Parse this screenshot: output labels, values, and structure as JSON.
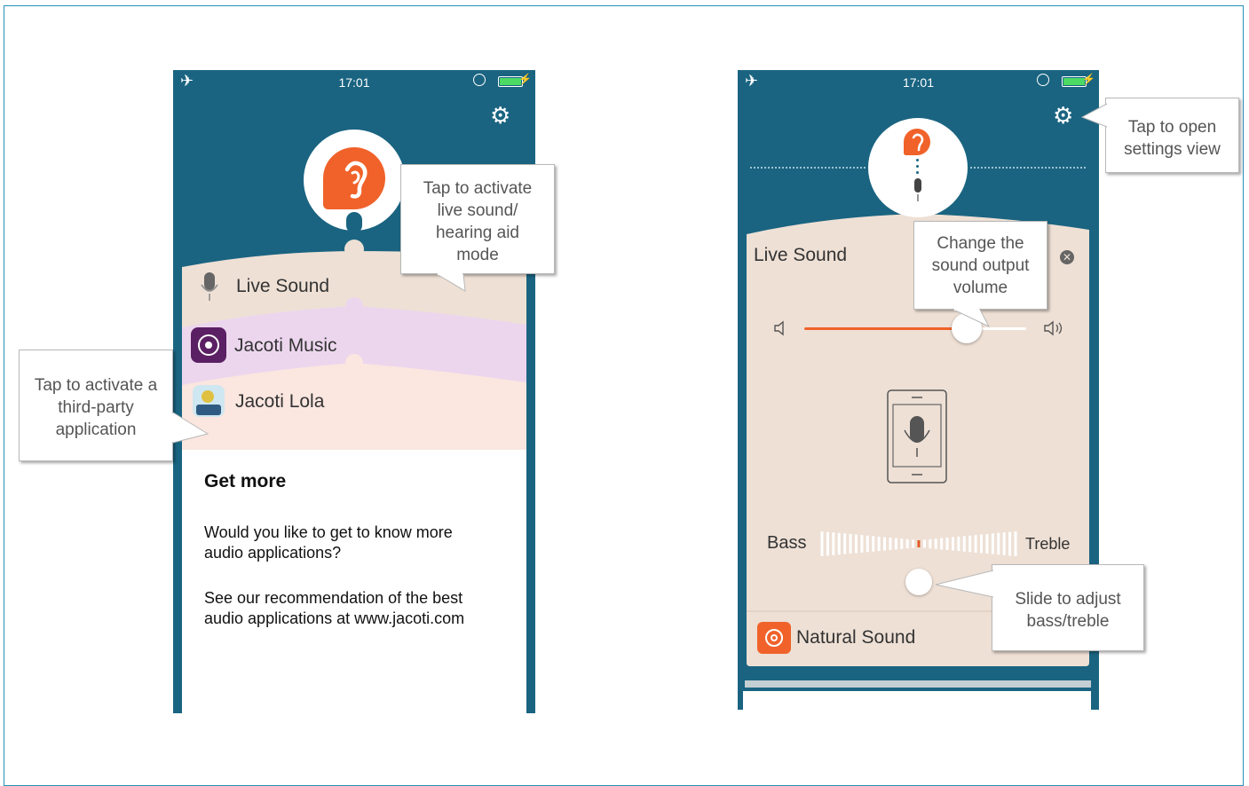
{
  "phones": {
    "left": {
      "status": {
        "time": "17:01"
      },
      "rows": [
        {
          "label": "Live Sound",
          "icon": "microphone-icon"
        },
        {
          "label": "Jacoti Music",
          "icon": "jacoti-music-icon"
        },
        {
          "label": "Jacoti Lola",
          "icon": "jacoti-lola-icon"
        }
      ],
      "get_more": {
        "title": "Get more",
        "line1a": "Would you like to get to know more",
        "line1b": "audio applications?",
        "line2a": "See our recommendation of the best",
        "line2b": "audio applications at www.jacoti.com"
      }
    },
    "right": {
      "status": {
        "time": "17:01"
      },
      "panel_title": "Live Sound",
      "volume_level": 0.73,
      "bass_label": "Bass",
      "treble_label": "Treble",
      "balance_level": 0.5,
      "preset_label": "Natural Sound"
    }
  },
  "callouts": {
    "live_sound": [
      "Tap to activate",
      "live sound/",
      "hearing aid",
      "mode"
    ],
    "third_party": [
      "Tap to activate a",
      "third-party",
      "application"
    ],
    "settings": [
      "Tap to open",
      "settings view"
    ],
    "volume": [
      "Change the",
      "sound output",
      "volume"
    ],
    "bass": [
      "Slide to adjust",
      "bass/treble"
    ]
  },
  "colors": {
    "phone_bg": "#1a6481",
    "accent_orange": "#f0622a",
    "live_sound_row": "#eee0d5",
    "music_row": "#ecd6ee",
    "lola_row": "#fbe6e0"
  }
}
